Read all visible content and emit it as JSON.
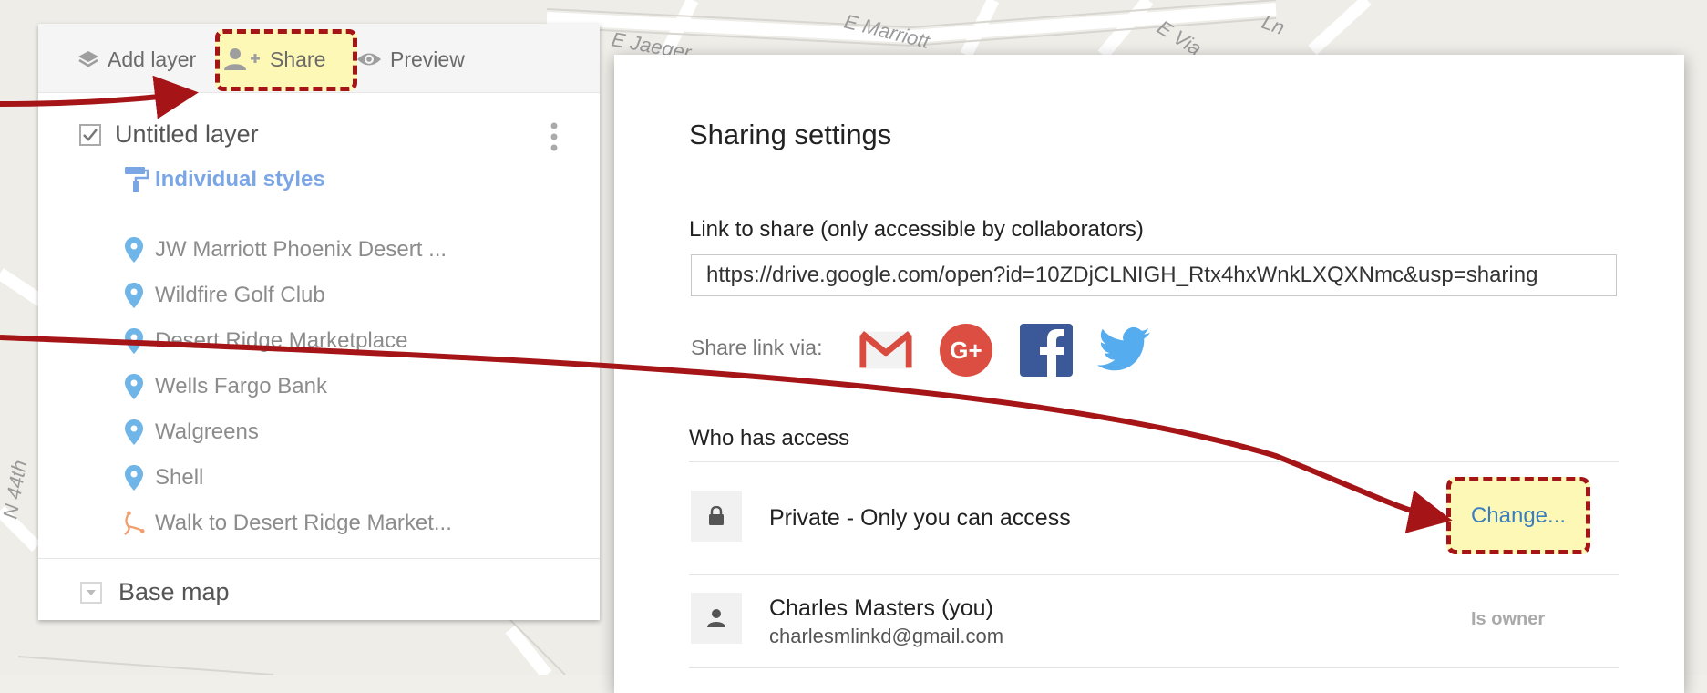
{
  "toolbar": {
    "add_layer": "Add layer",
    "share": "Share",
    "preview": "Preview"
  },
  "layer": {
    "name": "Untitled layer",
    "styles": "Individual styles",
    "features": [
      {
        "label": "JW Marriott Phoenix Desert ...",
        "icon": "map-pin-icon"
      },
      {
        "label": "Wildfire Golf Club",
        "icon": "map-pin-icon"
      },
      {
        "label": "Desert Ridge Marketplace",
        "icon": "map-pin-icon"
      },
      {
        "label": "Wells Fargo Bank",
        "icon": "map-pin-icon"
      },
      {
        "label": "Walgreens",
        "icon": "map-pin-icon"
      },
      {
        "label": "Shell",
        "icon": "map-pin-icon"
      },
      {
        "label": "Walk to Desert Ridge Market...",
        "icon": "walking-route-icon"
      }
    ]
  },
  "base_map": "Base map",
  "map_labels": {
    "street1": "E Jaeger",
    "street2": "E Marriott",
    "street3": "E Via",
    "street4": "Ln",
    "street5": "N 44th",
    "street6": "E Jaeger"
  },
  "dialog": {
    "title": "Sharing settings",
    "link_label": "Link to share (only accessible by collaborators)",
    "link_url": "https://drive.google.com/open?id=10ZDjCLNIGH_Rtx4hxWnkLXQXNmc&usp=sharing",
    "share_via": "Share link via:",
    "who_has_access": "Who has access",
    "private_text": "Private - Only you can access",
    "change_label": "Change...",
    "owner_name": "Charles Masters (you)",
    "owner_email": "charlesmlinkd@gmail.com",
    "owner_role": "Is owner"
  },
  "colors": {
    "highlight_fill": "#fdf8b6",
    "highlight_border": "#a51416",
    "arrow": "#a51416",
    "pin": "#6fb5e8",
    "link_blue": "#3b7ec0"
  }
}
